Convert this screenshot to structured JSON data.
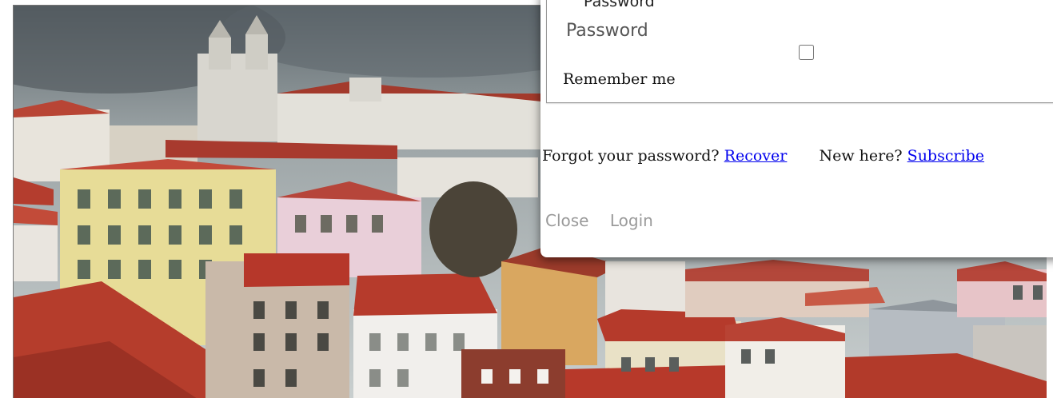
{
  "background": {
    "image": "lisbon-cityscape-photo"
  },
  "login_modal": {
    "password_legend": "Password",
    "password_placeholder": "Password",
    "remember_label": "Remember me",
    "forgot_text": "Forgot your password?",
    "recover_link": "Recover",
    "new_here_text": "New here?",
    "subscribe_link": "Subscribe",
    "close_button": "Close",
    "login_button": "Login"
  },
  "colors": {
    "link": "#0000ee",
    "muted_button": "#9a9a9a",
    "sky": "#9aa3a6",
    "roof": "#b33a2a"
  }
}
